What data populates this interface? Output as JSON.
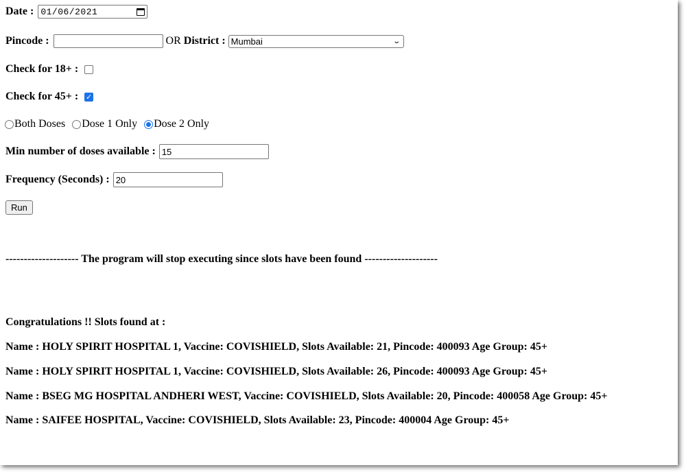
{
  "form": {
    "date_label": "Date :",
    "date_value": "01/06/2021",
    "pincode_label": "Pincode :",
    "pincode_value": "",
    "or_text": "OR",
    "district_label": "District :",
    "district_value": "Mumbai",
    "check18_label": "Check for 18+ :",
    "check18_checked": false,
    "check45_label": "Check for 45+ :",
    "check45_checked": true,
    "dose_options": [
      "Both Doses",
      "Dose 1 Only",
      "Dose 2 Only"
    ],
    "dose_selected": "Dose 2 Only",
    "min_doses_label": "Min number of doses available :",
    "min_doses_value": "15",
    "frequency_label": "Frequency (Seconds) :",
    "frequency_value": "20",
    "run_label": "Run"
  },
  "output": {
    "stop_message": "-------------------- The program will stop executing since slots have been found --------------------",
    "congrats": "Congratulations !! Slots found at :",
    "slots": [
      "Name : HOLY SPIRIT HOSPITAL 1, Vaccine: COVISHIELD, Slots Available: 21, Pincode: 400093 Age Group: 45+",
      "Name : HOLY SPIRIT HOSPITAL 1, Vaccine: COVISHIELD, Slots Available: 26, Pincode: 400093 Age Group: 45+",
      "Name : BSEG MG HOSPITAL ANDHERI WEST, Vaccine: COVISHIELD, Slots Available: 20, Pincode: 400058 Age Group: 45+",
      "Name : SAIFEE HOSPITAL, Vaccine: COVISHIELD, Slots Available: 23, Pincode: 400004 Age Group: 45+"
    ]
  },
  "icons": {
    "date_picker": "calendar-icon",
    "select": "chevron-down-icon",
    "checkmark": "checkmark-icon"
  },
  "colors": {
    "accent": "#1a73e8"
  }
}
